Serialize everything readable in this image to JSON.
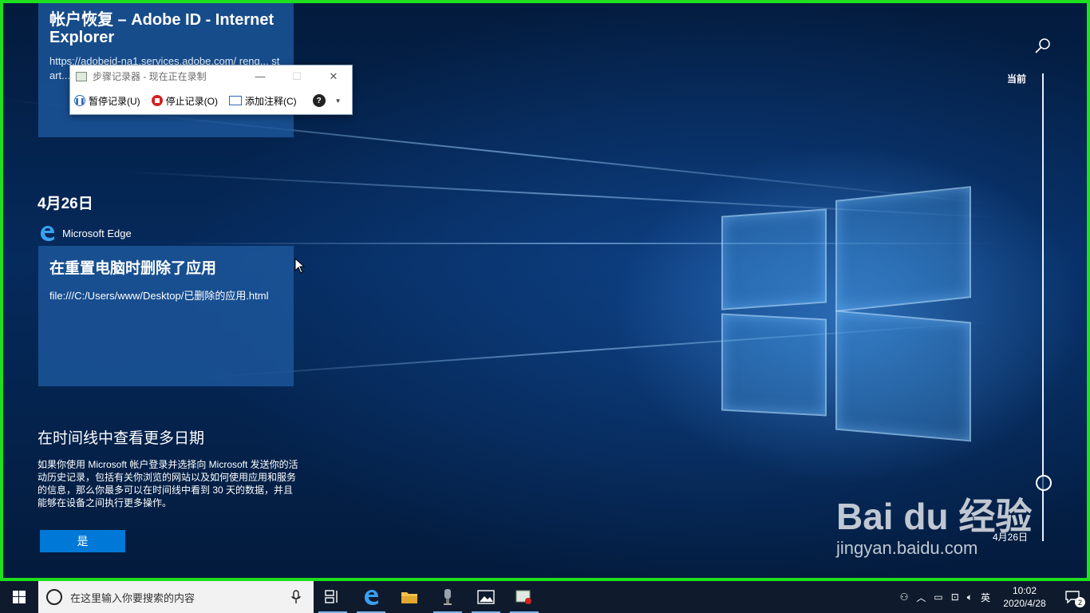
{
  "timeline": {
    "top_card": {
      "title": "帐户恢复 – Adobe ID - Internet Explorer",
      "url": "https://adobeid-na1.services.adobe.com/ reng... start..."
    },
    "date_heading": "4月26日",
    "app_name": "Microsoft Edge",
    "card": {
      "title": "在重置电脑时删除了应用",
      "url": "file:///C:/Users/www/Desktop/已删除的应用.html"
    },
    "promo": {
      "title": "在时间线中查看更多日期",
      "body": "如果你使用 Microsoft 帐户登录并选择向 Microsoft 发送你的活动历史记录，包括有关你浏览的网站以及如何使用应用和服务的信息，那么你最多可以在时间线中看到 30 天的数据，并且能够在设备之间执行更多操作。",
      "button": "是"
    },
    "scrubber": {
      "top_label": "当前",
      "bottom_label": "4月26日"
    }
  },
  "steps_recorder": {
    "title": "步骤记录器 - 现在正在录制",
    "pause": "暂停记录(U)",
    "stop": "停止记录(O)",
    "comment": "添加注释(C)"
  },
  "taskbar": {
    "search_placeholder": "在这里输入你要搜索的内容",
    "ime": "英",
    "time": "10:02",
    "date": "2020/4/28",
    "notification_count": "2"
  },
  "watermark": {
    "brand": "Bai du 经验",
    "url": "jingyan.baidu.com"
  },
  "colors": {
    "accent": "#0078d7",
    "frame": "#1ee01e",
    "card": "#1e5aa0"
  }
}
